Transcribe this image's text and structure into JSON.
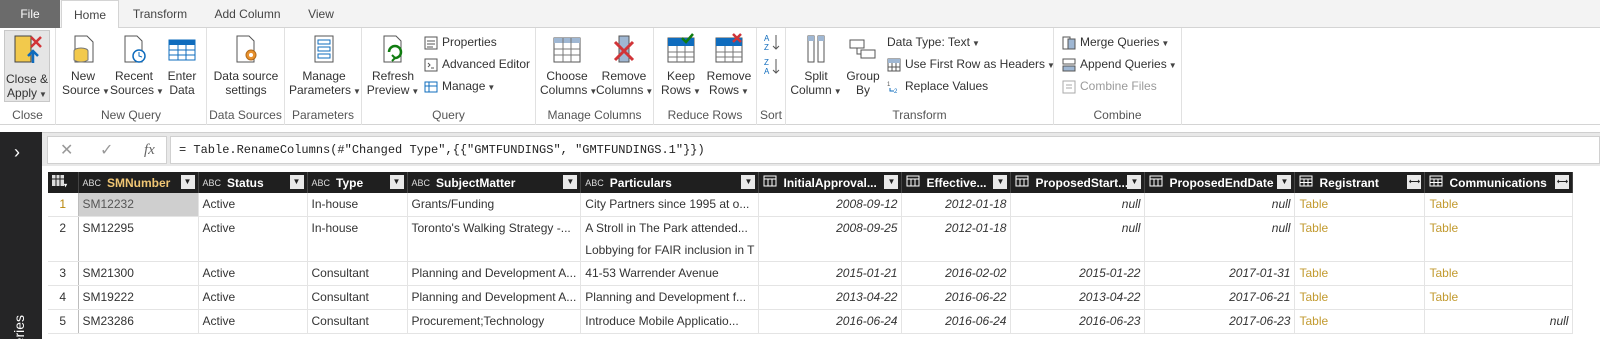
{
  "tabs": [
    "File",
    "Home",
    "Transform",
    "Add Column",
    "View"
  ],
  "ribbon": {
    "close": {
      "label1": "Close &",
      "label2": "Apply",
      "group": "Close"
    },
    "new_query": {
      "new_source1": "New",
      "new_source2": "Source",
      "recent1": "Recent",
      "recent2": "Sources",
      "enter1": "Enter",
      "enter2": "Data",
      "group": "New Query"
    },
    "data_sources": {
      "l1": "Data source",
      "l2": "settings",
      "group": "Data Sources"
    },
    "parameters": {
      "l1": "Manage",
      "l2": "Parameters",
      "group": "Parameters"
    },
    "query": {
      "refresh1": "Refresh",
      "refresh2": "Preview",
      "properties": "Properties",
      "advanced_editor": "Advanced Editor",
      "manage": "Manage",
      "group": "Query"
    },
    "manage_columns": {
      "choose1": "Choose",
      "choose2": "Columns",
      "remove1": "Remove",
      "remove2": "Columns",
      "group": "Manage Columns"
    },
    "reduce_rows": {
      "keep1": "Keep",
      "keep2": "Rows",
      "remove1": "Remove",
      "remove2": "Rows",
      "group": "Reduce Rows"
    },
    "sort": {
      "group": "Sort"
    },
    "transform": {
      "split1": "Split",
      "split2": "Column",
      "group1": "Group",
      "group2": "By",
      "data_type": "Data Type: Text",
      "first_row": "Use First Row as Headers",
      "replace": "Replace Values",
      "group": "Transform"
    },
    "combine": {
      "merge": "Merge Queries",
      "append": "Append Queries",
      "combine_files": "Combine Files",
      "group": "Combine"
    }
  },
  "queries_pane": {
    "label": "Queries"
  },
  "formula": {
    "text": "= Table.RenameColumns(#\"Changed Type\",{{\"GMTFUNDINGS\", \"GMTFUNDINGS.1\"}})",
    "fx": "fx"
  },
  "grid": {
    "columns": [
      "SMNumber",
      "Status",
      "Type",
      "SubjectMatter",
      "Particulars",
      "InitialApproval...",
      "Effective...",
      "ProposedStart...",
      "ProposedEndDate",
      "Registrant",
      "Communications"
    ],
    "type_abc": "ABC",
    "rows": [
      {
        "n": "1",
        "c": [
          "SM12232",
          "Active",
          "In-house",
          "Grants/Funding",
          "City Partners since 1995 at o...",
          "2008-09-12",
          "2012-01-18",
          "null",
          "null",
          "Table",
          "Table"
        ]
      },
      {
        "n": "2",
        "c": [
          "SM12295",
          "Active",
          "In-house",
          "Toronto's Walking Strategy -...",
          "A Stroll in The Park attended...",
          "2008-09-25",
          "2012-01-18",
          "null",
          "null",
          "Table",
          "Table"
        ],
        "extra": "Lobbying for FAIR inclusion in T"
      },
      {
        "n": "3",
        "c": [
          "SM21300",
          "Active",
          "Consultant",
          "Planning and Development A...",
          "41-53 Warrender Avenue",
          "2015-01-21",
          "2016-02-02",
          "2015-01-22",
          "2017-01-31",
          "Table",
          "Table"
        ]
      },
      {
        "n": "4",
        "c": [
          "SM19222",
          "Active",
          "Consultant",
          "Planning and Development A...",
          "Planning and Development f...",
          "2013-04-22",
          "2016-06-22",
          "2013-04-22",
          "2017-06-21",
          "Table",
          "Table"
        ]
      },
      {
        "n": "5",
        "c": [
          "SM23286",
          "Active",
          "Consultant",
          "Procurement;Technology",
          "Introduce Mobile Applicatio...",
          "2016-06-24",
          "2016-06-24",
          "2016-06-23",
          "2017-06-23",
          "Table",
          "null"
        ]
      }
    ]
  }
}
